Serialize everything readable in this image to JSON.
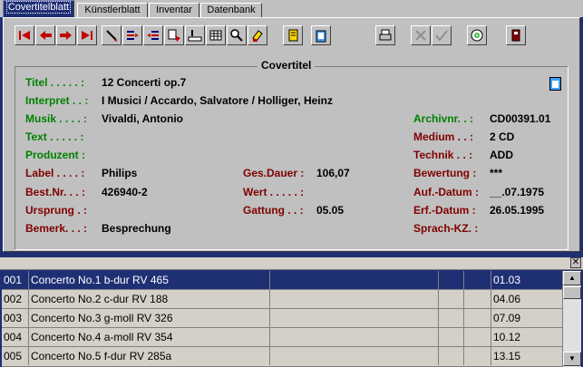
{
  "tabs": [
    "Covertitelblatt",
    "Künstlerblatt",
    "Inventar",
    "Datenbank"
  ],
  "panel": {
    "title": "Covertitel"
  },
  "fields": {
    "titel": {
      "label": "Titel . . . . . :",
      "value": "12 Concerti op.7"
    },
    "interpret": {
      "label": "Interpret . . :",
      "value": "I Musici / Accardo, Salvatore / Holliger, Heinz"
    },
    "musik": {
      "label": "Musik . . . . :",
      "value": "Vivaldi, Antonio"
    },
    "text": {
      "label": "Text . . . . . :",
      "value": ""
    },
    "produzent": {
      "label": "Produzent :",
      "value": ""
    },
    "label": {
      "label": "Label . . . . :",
      "value": "Philips"
    },
    "bestnr": {
      "label": "Best.Nr. . . :",
      "value": "426940-2"
    },
    "ursprung": {
      "label": "Ursprung . :",
      "value": ""
    },
    "bemerk": {
      "label": "Bemerk. . . :",
      "value": "Besprechung"
    },
    "gesdauer": {
      "label": "Ges.Dauer :",
      "value": "106,07"
    },
    "wert": {
      "label": "Wert . . . . . :",
      "value": ""
    },
    "gattung": {
      "label": "Gattung . . :",
      "value": "05.05"
    },
    "archivnr": {
      "label": "Archivnr. . :",
      "value": "CD00391.01"
    },
    "medium": {
      "label": "Medium . . :",
      "value": "2 CD"
    },
    "technik": {
      "label": "Technik . . :",
      "value": "ADD"
    },
    "bewertung": {
      "label": "Bewertung :",
      "value": "***"
    },
    "aufdatum": {
      "label": "Auf.-Datum :",
      "value": "__.07.1975"
    },
    "erfdatum": {
      "label": "Erf.-Datum :",
      "value": "26.05.1995"
    },
    "sprachkz": {
      "label": "Sprach-KZ. :",
      "value": ""
    }
  },
  "rows": [
    {
      "num": "001",
      "title": "Concerto No.1 b-dur RV 465",
      "time": "01.03"
    },
    {
      "num": "002",
      "title": "Concerto No.2 c-dur RV 188",
      "time": "04.06"
    },
    {
      "num": "003",
      "title": "Concerto No.3 g-moll RV 326",
      "time": "07.09"
    },
    {
      "num": "004",
      "title": "Concerto No.4 a-moll RV 354",
      "time": "10.12"
    },
    {
      "num": "005",
      "title": "Concerto No.5 f-dur RV 285a",
      "time": "13.15"
    }
  ],
  "icons": [
    "first-record-icon",
    "prev-record-icon",
    "next-record-icon",
    "last-record-icon",
    "edit-pencil-icon",
    "insert-record-icon",
    "delete-record-icon",
    "copy-record-icon",
    "id-number-icon",
    "table-view-icon",
    "search-icon",
    "filter-icon",
    "scroll-report-icon",
    "notes-icon",
    "print-icon",
    "cancel-icon",
    "confirm-icon",
    "cd-icon",
    "exit-icon"
  ],
  "colors": {
    "selection": "#1f2f74",
    "label_green": "#008000",
    "label_red": "#800000"
  }
}
